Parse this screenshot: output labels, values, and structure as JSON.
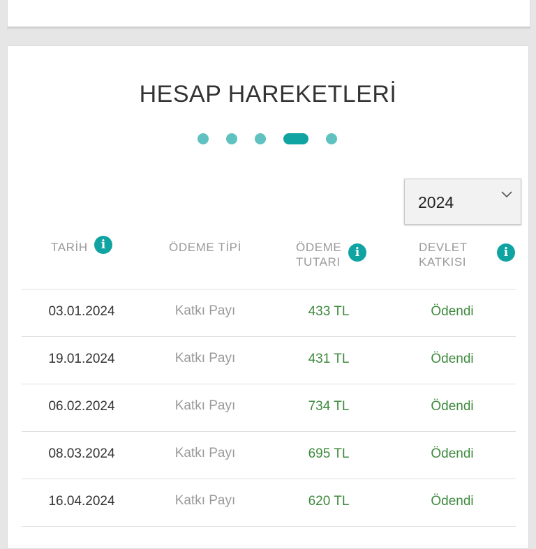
{
  "section": {
    "title": "HESAP HAREKETLERİ"
  },
  "pager": {
    "count": 5,
    "active_index": 3
  },
  "year_select": {
    "value": "2024",
    "icon": "chevron-down-icon"
  },
  "table": {
    "headers": [
      {
        "line1": "TARİH",
        "line2": "",
        "info_icon": "i"
      },
      {
        "line1": "ÖDEME TİPİ",
        "line2": "",
        "info_icon": ""
      },
      {
        "line1": "ÖDEME",
        "line2": "TUTARI",
        "info_icon": "i"
      },
      {
        "line1": "DEVLET",
        "line2": "KATKISI",
        "info_icon": "i"
      }
    ],
    "rows": [
      {
        "date": "03.01.2024",
        "type": "Katkı Payı",
        "amount": "433 TL",
        "status": "Ödendi"
      },
      {
        "date": "19.01.2024",
        "type": "Katkı Payı",
        "amount": "431 TL",
        "status": "Ödendi"
      },
      {
        "date": "06.02.2024",
        "type": "Katkı Payı",
        "amount": "734 TL",
        "status": "Ödendi"
      },
      {
        "date": "08.03.2024",
        "type": "Katkı Payı",
        "amount": "695 TL",
        "status": "Ödendi"
      },
      {
        "date": "16.04.2024",
        "type": "Katkı Payı",
        "amount": "620 TL",
        "status": "Ödendi"
      }
    ]
  },
  "colors": {
    "accent": "#0fa3a1",
    "accent_light": "#5fc1c0",
    "positive": "#3e8a3e",
    "muted": "#9a9a9a"
  }
}
